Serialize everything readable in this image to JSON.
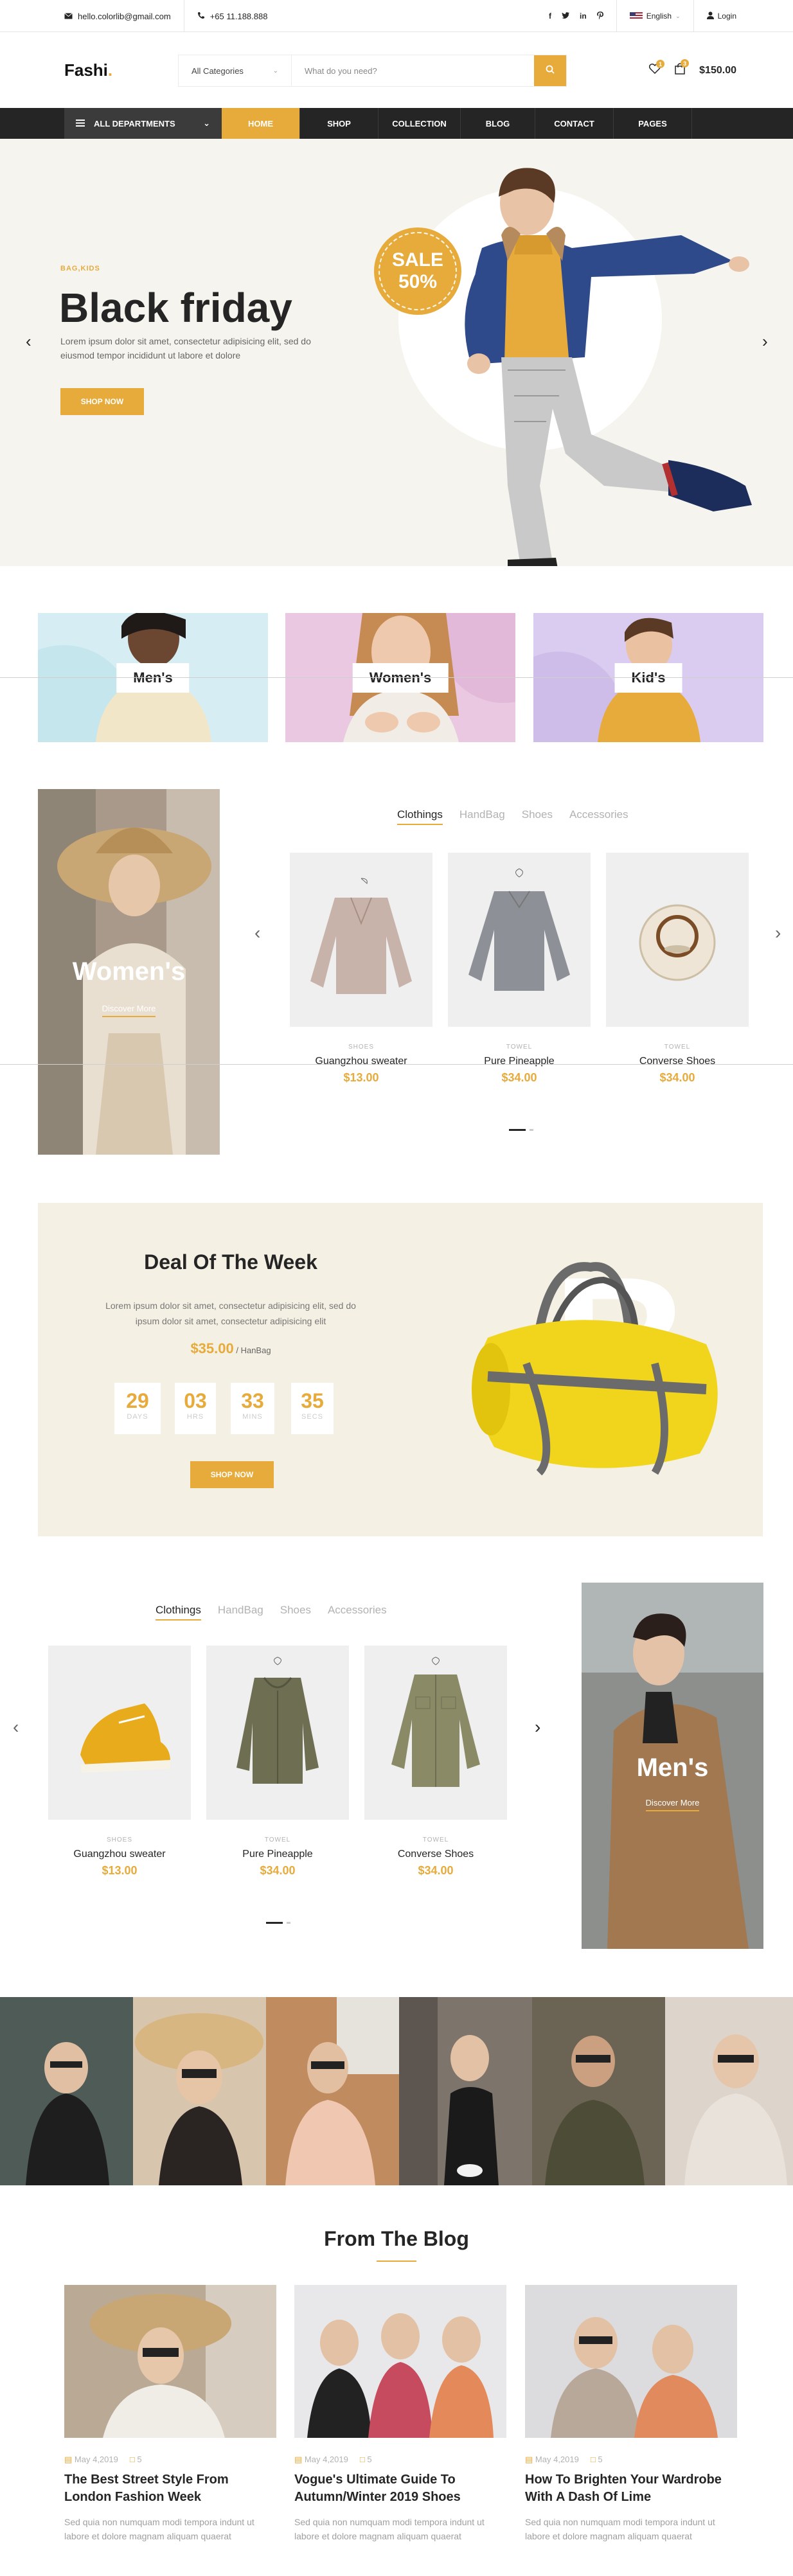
{
  "topbar": {
    "email": "hello.colorlib@gmail.com",
    "phone": "+65 11.188.888",
    "language": "English",
    "login": "Login"
  },
  "header": {
    "logo": "Fashi",
    "category_select": "All Categories",
    "search_placeholder": "What do you need?",
    "wishlist_count": "1",
    "cart_count": "3",
    "cart_total": "$150.00"
  },
  "nav": {
    "departments": "ALL DEPARTMENTS",
    "items": [
      "HOME",
      "SHOP",
      "COLLECTION",
      "BLOG",
      "CONTACT",
      "PAGES"
    ]
  },
  "hero": {
    "tag": "BAG,KIDS",
    "title": "Black friday",
    "text": "Lorem ipsum dolor sit amet, consectetur adipisicing elit, sed do eiusmod tempor incididunt ut labore et dolore",
    "button": "SHOP NOW",
    "sale_label": "SALE",
    "sale_value": "50%"
  },
  "categories": [
    "Men's",
    "Women's",
    "Kid's"
  ],
  "women_section": {
    "banner_title": "Women's",
    "banner_link": "Discover More",
    "tabs": [
      "Clothings",
      "HandBag",
      "Shoes",
      "Accessories"
    ],
    "products": [
      {
        "category": "SHOES",
        "name": "Guangzhou sweater",
        "price": "$13.00"
      },
      {
        "category": "TOWEL",
        "name": "Pure Pineapple",
        "price": "$34.00"
      },
      {
        "category": "TOWEL",
        "name": "Converse Shoes",
        "price": "$34.00"
      }
    ]
  },
  "deal": {
    "title": "Deal Of The Week",
    "text": "Lorem ipsum dolor sit amet, consectetur adipisicing elit, sed do ipsum dolor sit amet, consectetur adipisicing elit",
    "price": "$35.00",
    "price_suffix": " / HanBag",
    "countdown": [
      {
        "value": "29",
        "unit": "DAYS"
      },
      {
        "value": "03",
        "unit": "HRS"
      },
      {
        "value": "33",
        "unit": "MINS"
      },
      {
        "value": "35",
        "unit": "SECS"
      }
    ],
    "button": "SHOP NOW",
    "watermark": "B"
  },
  "men_section": {
    "banner_title": "Men's",
    "banner_link": "Discover More",
    "tabs": [
      "Clothings",
      "HandBag",
      "Shoes",
      "Accessories"
    ],
    "products": [
      {
        "category": "SHOES",
        "name": "Guangzhou sweater",
        "price": "$13.00"
      },
      {
        "category": "TOWEL",
        "name": "Pure Pineapple",
        "price": "$34.00"
      },
      {
        "category": "TOWEL",
        "name": "Converse Shoes",
        "price": "$34.00"
      }
    ]
  },
  "blog": {
    "title": "From The Blog",
    "posts": [
      {
        "date": "May 4,2019",
        "comments": "5",
        "title": "The Best Street Style From London Fashion Week",
        "excerpt": "Sed quia non numquam modi tempora indunt ut labore et dolore magnam aliquam quaerat"
      },
      {
        "date": "May 4,2019",
        "comments": "5",
        "title": "Vogue's Ultimate Guide To Autumn/Winter 2019 Shoes",
        "excerpt": "Sed quia non numquam modi tempora indunt ut labore et dolore magnam aliquam quaerat"
      },
      {
        "date": "May 4,2019",
        "comments": "5",
        "title": "How To Brighten Your Wardrobe With A Dash Of Lime",
        "excerpt": "Sed quia non numquam modi tempora indunt ut labore et dolore magnam aliquam quaerat"
      }
    ]
  },
  "colors": {
    "accent": "#e7ab3c",
    "dark": "#252525"
  }
}
